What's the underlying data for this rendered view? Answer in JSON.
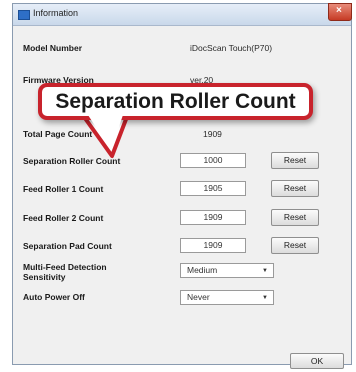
{
  "window": {
    "title": "Information"
  },
  "fields": [
    {
      "label": "Model Number",
      "value": "iDocScan Touch(P70)"
    },
    {
      "label": "Firmware Version",
      "value": "ver.20"
    },
    {
      "label": "Total Page Count",
      "value": "1909"
    }
  ],
  "counters": [
    {
      "label": "Separation Roller Count",
      "value": "1000",
      "button": "Reset"
    },
    {
      "label": "Feed Roller 1 Count",
      "value": "1905",
      "button": "Reset"
    },
    {
      "label": "Feed Roller 2 Count",
      "value": "1909",
      "button": "Reset"
    },
    {
      "label": "Separation Pad Count",
      "value": "1909",
      "button": "Reset"
    }
  ],
  "settings": [
    {
      "label": "Multi-Feed Detection Sensitivity",
      "value": "Medium"
    },
    {
      "label": "Auto Power Off",
      "value": "Never"
    }
  ],
  "ok_label": "OK",
  "callout": {
    "text": "Separation Roller Count",
    "border_color": "#c8232c"
  }
}
